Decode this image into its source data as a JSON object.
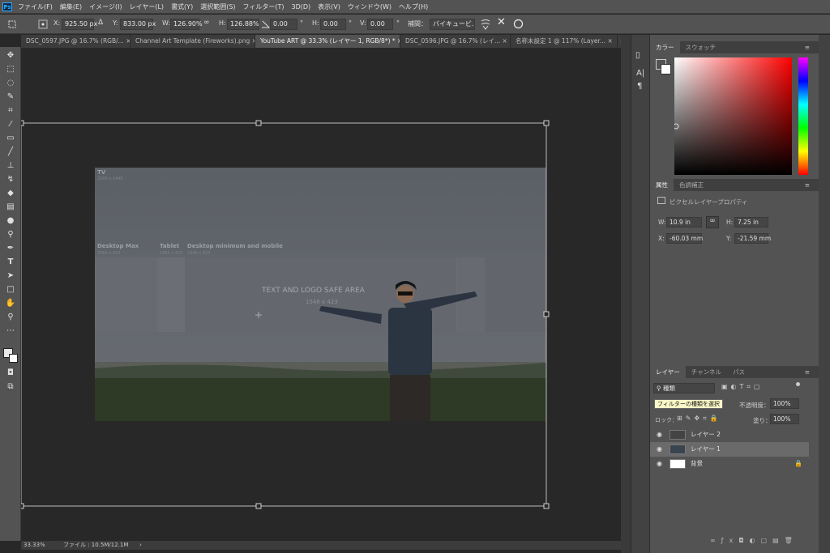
{
  "app": {
    "logo": "Ps"
  },
  "menu": [
    "ファイル(F)",
    "編集(E)",
    "イメージ(I)",
    "レイヤー(L)",
    "書式(Y)",
    "選択範囲(S)",
    "フィルター(T)",
    "3D(D)",
    "表示(V)",
    "ウィンドウ(W)",
    "ヘルプ(H)"
  ],
  "options": {
    "x_label": "X:",
    "x_value": "925.50 px",
    "y_label": "Y:",
    "y_value": "833.00 px",
    "w_label": "W:",
    "w_value": "126.90%",
    "h_label": "H:",
    "h_value": "126.88%",
    "angle_value": "0.00",
    "angle_unit": "°",
    "hskew_label": "H:",
    "hskew_value": "0.00",
    "vskew_label": "V:",
    "vskew_value": "0.00",
    "interp_label": "補間：",
    "interp_value": "バイキュービ..."
  },
  "tabs": [
    {
      "label": "DSC_0597.JPG @ 16.7% (RGB/...",
      "close": "×"
    },
    {
      "label": "Channel Art Template (Fireworks).png",
      "close": "×"
    },
    {
      "label": "YouTube ART @ 33.3% (レイヤー 1, RGB/8*) *",
      "close": "×"
    },
    {
      "label": "DSC_0596.JPG @ 16.7% (レイ...",
      "close": "×"
    },
    {
      "label": "名称未設定 1 @ 117% (Layer...",
      "close": "×"
    }
  ],
  "tabs_overflow": "»",
  "artboard": {
    "tv_label": "TV",
    "tv_size": "2560 x 1440",
    "desktop_max_label": "Desktop Max",
    "desktop_max_size": "2560 x 423",
    "tablet_label": "Tablet",
    "tablet_size": "1855 x 423",
    "desktop_min_label": "Desktop minimum and mobile",
    "desktop_min_size": "1546 x 423",
    "safe_area_label": "TEXT AND LOGO SAFE AREA",
    "safe_area_size": "1546 x 423"
  },
  "status": {
    "zoom": "33.33%",
    "file": "ファイル : 10.5M/12.1M",
    "arrow": "›"
  },
  "color_panel": {
    "tabs": [
      "カラー",
      "スウォッチ"
    ],
    "menu": "≡"
  },
  "properties_panel": {
    "tabs": [
      "属性",
      "色調補正"
    ],
    "menu": "≡",
    "kind": "ピクセルレイヤープロパティ",
    "w_label": "W:",
    "w_value": "10.9 in",
    "h_label": "H:",
    "h_value": "7.25 in",
    "x_label": "X:",
    "x_value": "-60.03 mm",
    "y_label": "Y:",
    "y_value": "-21.59 mm"
  },
  "layers_panel": {
    "tabs": [
      "レイヤー",
      "チャンネル",
      "パス"
    ],
    "menu": "≡",
    "filter_label": "種類",
    "tooltip": "フィルターの種類を選択",
    "opacity_label": "不透明度：",
    "opacity_value": "100%",
    "lock_label": "ロック：",
    "fill_label": "塗り：",
    "fill_value": "100%",
    "layers": [
      {
        "name": "レイヤー 2",
        "selected": false,
        "locked": false
      },
      {
        "name": "レイヤー 1",
        "selected": true,
        "locked": false
      },
      {
        "name": "背景",
        "selected": false,
        "locked": true
      }
    ]
  },
  "colors": {
    "accent": "#31a8ff",
    "panel": "#535353",
    "canvas_bg": "#282828"
  }
}
